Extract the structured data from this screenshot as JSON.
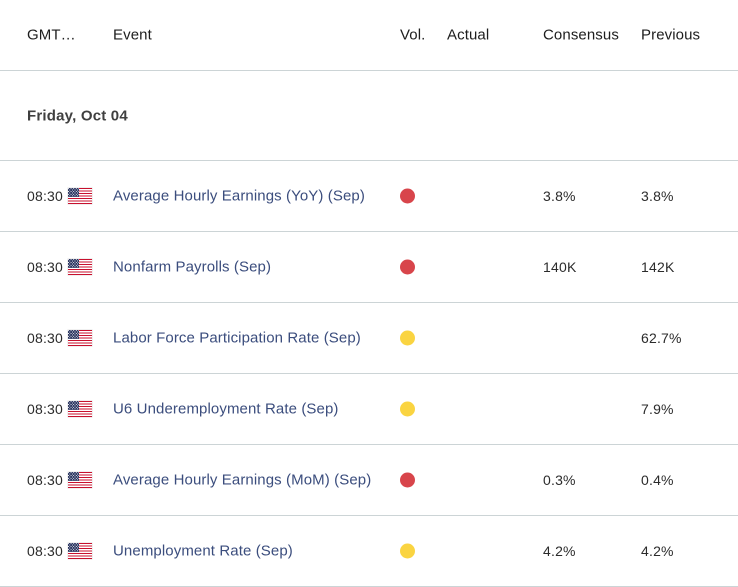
{
  "table": {
    "columns": {
      "time": "GMT…",
      "event": "Event",
      "volatility": "Vol.",
      "actual": "Actual",
      "consensus": "Consensus",
      "previous": "Previous"
    },
    "date_group": "Friday, Oct 04",
    "rows": [
      {
        "time": "08:30",
        "country": "United States",
        "flag_icon": "us-flag-icon",
        "event": "Average Hourly Earnings (YoY) (Sep)",
        "volatility": "high",
        "volatility_color": "#d8454b",
        "actual": "",
        "consensus": "3.8%",
        "previous": "3.8%"
      },
      {
        "time": "08:30",
        "country": "United States",
        "flag_icon": "us-flag-icon",
        "event": "Nonfarm Payrolls (Sep)",
        "volatility": "high",
        "volatility_color": "#d8454b",
        "actual": "",
        "consensus": "140K",
        "previous": "142K"
      },
      {
        "time": "08:30",
        "country": "United States",
        "flag_icon": "us-flag-icon",
        "event": "Labor Force Participation Rate (Sep)",
        "volatility": "medium",
        "volatility_color": "#fad441",
        "actual": "",
        "consensus": "",
        "previous": "62.7%"
      },
      {
        "time": "08:30",
        "country": "United States",
        "flag_icon": "us-flag-icon",
        "event": "U6 Underemployment Rate (Sep)",
        "volatility": "medium",
        "volatility_color": "#fad441",
        "actual": "",
        "consensus": "",
        "previous": "7.9%"
      },
      {
        "time": "08:30",
        "country": "United States",
        "flag_icon": "us-flag-icon",
        "event": "Average Hourly Earnings (MoM) (Sep)",
        "volatility": "high",
        "volatility_color": "#d8454b",
        "actual": "",
        "consensus": "0.3%",
        "previous": "0.4%"
      },
      {
        "time": "08:30",
        "country": "United States",
        "flag_icon": "us-flag-icon",
        "event": "Unemployment Rate (Sep)",
        "volatility": "medium",
        "volatility_color": "#fad441",
        "actual": "",
        "consensus": "4.2%",
        "previous": "4.2%"
      }
    ]
  },
  "theme": {
    "link_color": "#3b4d7d",
    "divider_color": "#ccd4d6",
    "text_color": "#2b2b2b",
    "date_color": "#3f3f3f",
    "background": "#ffffff"
  }
}
